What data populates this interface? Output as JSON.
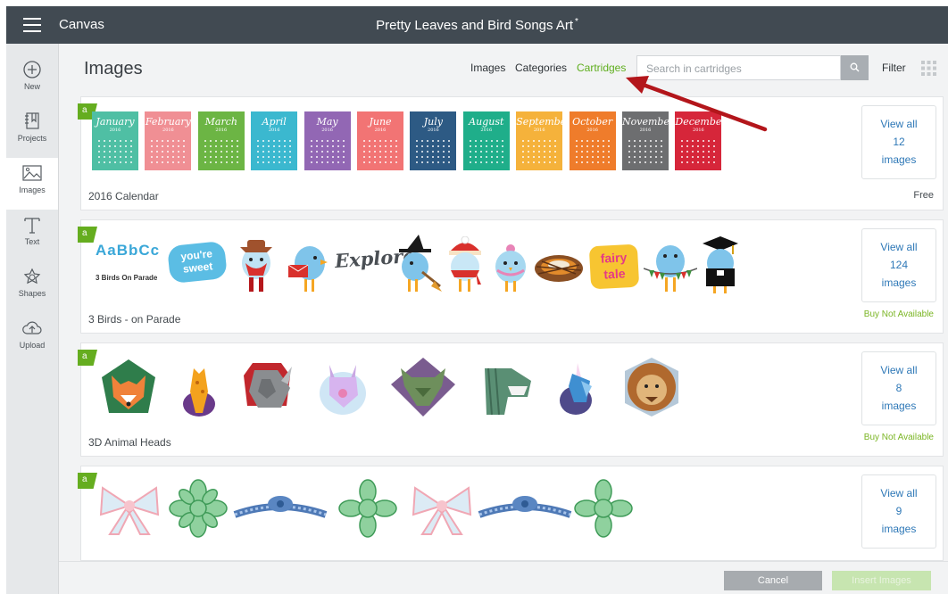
{
  "topbar": {
    "app_title": "Canvas",
    "doc_title": "Pretty Leaves and Bird Songs Art",
    "doc_unsaved_mark": "*"
  },
  "sidebar": {
    "items": [
      {
        "label": "New",
        "icon": "plus-circle-icon"
      },
      {
        "label": "Projects",
        "icon": "projects-icon"
      },
      {
        "label": "Images",
        "icon": "image-icon",
        "active": true
      },
      {
        "label": "Text",
        "icon": "text-icon"
      },
      {
        "label": "Shapes",
        "icon": "shapes-icon"
      },
      {
        "label": "Upload",
        "icon": "upload-cloud-icon"
      }
    ]
  },
  "header": {
    "title": "Images",
    "tabs": [
      {
        "label": "Images"
      },
      {
        "label": "Categories"
      },
      {
        "label": "Cartridges",
        "active": true
      }
    ],
    "search_placeholder": "Search in cartridges",
    "filter_label": "Filter"
  },
  "colors": {
    "accent_green": "#5fae1e",
    "topbar": "#414a52",
    "link_blue": "#2e78b7",
    "annotation_arrow": "#b3161b"
  },
  "cartridges": [
    {
      "name": "2016 Calendar",
      "status": "Free",
      "view_all": {
        "line1": "View all",
        "count": "12",
        "line3": "images"
      },
      "months": [
        {
          "label": "January",
          "year": "2016",
          "color": "#4fbfa4"
        },
        {
          "label": "February",
          "year": "2016",
          "color": "#f08f94"
        },
        {
          "label": "March",
          "year": "2016",
          "color": "#6cb544"
        },
        {
          "label": "April",
          "year": "2016",
          "color": "#3bb8cf"
        },
        {
          "label": "May",
          "year": "2016",
          "color": "#9267b4"
        },
        {
          "label": "June",
          "year": "2016",
          "color": "#f27474"
        },
        {
          "label": "July",
          "year": "2016",
          "color": "#2d5a84"
        },
        {
          "label": "August",
          "year": "2016",
          "color": "#1fae8a"
        },
        {
          "label": "September",
          "year": "2016",
          "color": "#f5b23b"
        },
        {
          "label": "October",
          "year": "2016",
          "color": "#ef7c2b"
        },
        {
          "label": "November",
          "year": "2016",
          "color": "#6d6e70"
        },
        {
          "label": "December",
          "year": "2016",
          "color": "#d6263a"
        }
      ]
    },
    {
      "name": "3 Birds - on Parade",
      "status": "Buy Not Available",
      "view_all": {
        "line1": "View all",
        "count": "124",
        "line3": "images"
      },
      "art": {
        "alphabet": "AaBbCc",
        "caption": "3 Birds On Parade",
        "sweet": "you're sweet",
        "explore": "Explore",
        "fairy": "fairy tale"
      }
    },
    {
      "name": "3D Animal Heads",
      "status": "Buy Not Available",
      "view_all": {
        "line1": "View all",
        "count": "8",
        "line3": "images"
      }
    },
    {
      "name": "",
      "status": "",
      "view_all": {
        "line1": "View all",
        "count": "9",
        "line3": "images"
      }
    }
  ],
  "footer": {
    "cancel_label": "Cancel",
    "insert_label": "Insert Images"
  }
}
